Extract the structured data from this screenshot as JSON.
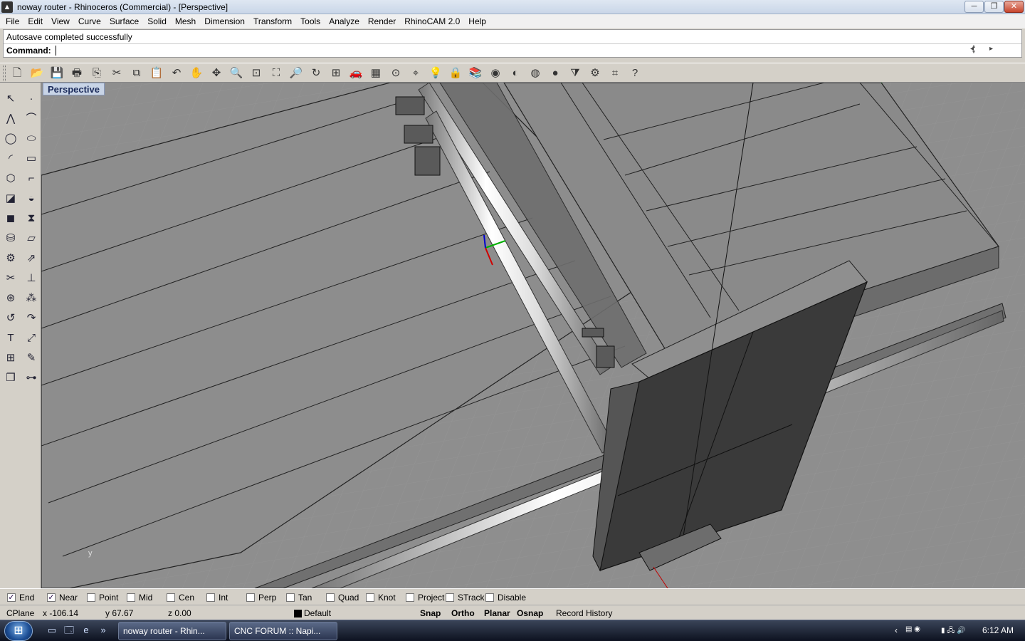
{
  "window": {
    "title": "noway router - Rhinoceros (Commercial) - [Perspective]",
    "buttons": {
      "minimize": "─",
      "maximize": "❐",
      "close": "✕"
    }
  },
  "menu": [
    "File",
    "Edit",
    "View",
    "Curve",
    "Surface",
    "Solid",
    "Mesh",
    "Dimension",
    "Transform",
    "Tools",
    "Analyze",
    "Render",
    "RhinoCAM 2.0",
    "Help"
  ],
  "command": {
    "history": "Autosave completed successfully",
    "label": "Command:",
    "value": ""
  },
  "toolbar": [
    {
      "name": "new-icon",
      "glyph": "🗋"
    },
    {
      "name": "open-icon",
      "glyph": "📂"
    },
    {
      "name": "save-icon",
      "glyph": "💾"
    },
    {
      "name": "print-icon",
      "glyph": "🖶"
    },
    {
      "name": "import-icon",
      "glyph": "⎘"
    },
    {
      "name": "cut-icon",
      "glyph": "✂"
    },
    {
      "name": "copy-icon",
      "glyph": "⧉"
    },
    {
      "name": "paste-icon",
      "glyph": "📋"
    },
    {
      "name": "undo-icon",
      "glyph": "↶"
    },
    {
      "name": "pan-icon",
      "glyph": "✋"
    },
    {
      "name": "move-view-icon",
      "glyph": "✥"
    },
    {
      "name": "zoom-icon",
      "glyph": "🔍"
    },
    {
      "name": "zoom-window-icon",
      "glyph": "⊡"
    },
    {
      "name": "zoom-extents-icon",
      "glyph": "⛶"
    },
    {
      "name": "zoom-selected-icon",
      "glyph": "🔎"
    },
    {
      "name": "rotate-view-icon",
      "glyph": "↻"
    },
    {
      "name": "viewport-layout-icon",
      "glyph": "⊞"
    },
    {
      "name": "car-icon",
      "glyph": "🚗"
    },
    {
      "name": "grid-icon",
      "glyph": "▦"
    },
    {
      "name": "point-icon",
      "glyph": "⊙"
    },
    {
      "name": "snap-icon",
      "glyph": "⌖"
    },
    {
      "name": "light-icon",
      "glyph": "💡"
    },
    {
      "name": "lock-icon",
      "glyph": "🔒"
    },
    {
      "name": "layer-icon",
      "glyph": "📚"
    },
    {
      "name": "color-wheel-icon",
      "glyph": "◉"
    },
    {
      "name": "shade-icon",
      "glyph": "◐"
    },
    {
      "name": "wire-sphere-icon",
      "glyph": "◍"
    },
    {
      "name": "render-sphere-icon",
      "glyph": "●"
    },
    {
      "name": "filter-icon",
      "glyph": "⧩"
    },
    {
      "name": "settings-icon",
      "glyph": "⚙"
    },
    {
      "name": "dimension-icon",
      "glyph": "⌗"
    },
    {
      "name": "help-icon",
      "glyph": "?"
    }
  ],
  "left_toolbar": [
    {
      "name": "select-icon",
      "glyph": "↖"
    },
    {
      "name": "point-icon",
      "glyph": "·"
    },
    {
      "name": "polyline-icon",
      "glyph": "⋀"
    },
    {
      "name": "curve-icon",
      "glyph": "⌒"
    },
    {
      "name": "circle-icon",
      "glyph": "◯"
    },
    {
      "name": "ellipse-icon",
      "glyph": "⬭"
    },
    {
      "name": "arc-icon",
      "glyph": "◜"
    },
    {
      "name": "rectangle-icon",
      "glyph": "▭"
    },
    {
      "name": "polygon-icon",
      "glyph": "⬡"
    },
    {
      "name": "fillet-icon",
      "glyph": "⌐"
    },
    {
      "name": "surface-icon",
      "glyph": "◪"
    },
    {
      "name": "loft-icon",
      "glyph": "◒"
    },
    {
      "name": "box-icon",
      "glyph": "◼"
    },
    {
      "name": "boolean-icon",
      "glyph": "⧗"
    },
    {
      "name": "cylinder-icon",
      "glyph": "⛁"
    },
    {
      "name": "plane-icon",
      "glyph": "▱"
    },
    {
      "name": "mesh-icon",
      "glyph": "⚙"
    },
    {
      "name": "extrude-icon",
      "glyph": "⇗"
    },
    {
      "name": "trim-icon",
      "glyph": "✂"
    },
    {
      "name": "split-icon",
      "glyph": "⊥"
    },
    {
      "name": "join-icon",
      "glyph": "⊛"
    },
    {
      "name": "explode-icon",
      "glyph": "⁂"
    },
    {
      "name": "rotate-icon",
      "glyph": "↺"
    },
    {
      "name": "move-icon",
      "glyph": "↷"
    },
    {
      "name": "text-icon",
      "glyph": "T"
    },
    {
      "name": "scale-icon",
      "glyph": "⤢"
    },
    {
      "name": "array-icon",
      "glyph": "⊞"
    },
    {
      "name": "edit-icon",
      "glyph": "✎"
    },
    {
      "name": "solid-box-icon",
      "glyph": "❒"
    },
    {
      "name": "dimension-icon",
      "glyph": "⊶"
    }
  ],
  "viewport": {
    "title": "Perspective",
    "axis_label": "y"
  },
  "osnaps": [
    {
      "label": "End",
      "checked": true
    },
    {
      "label": "Near",
      "checked": true
    },
    {
      "label": "Point",
      "checked": false
    },
    {
      "label": "Mid",
      "checked": false
    },
    {
      "label": "Cen",
      "checked": false
    },
    {
      "label": "Int",
      "checked": false
    },
    {
      "label": "Perp",
      "checked": false
    },
    {
      "label": "Tan",
      "checked": false
    },
    {
      "label": "Quad",
      "checked": false
    },
    {
      "label": "Knot",
      "checked": false
    },
    {
      "label": "Project",
      "checked": false
    },
    {
      "label": "STrack",
      "checked": false
    },
    {
      "label": "Disable",
      "checked": false
    }
  ],
  "status": {
    "cplane": "CPlane",
    "x": "x -106.14",
    "y": "y 67.67",
    "z": "z 0.00",
    "layer": "Default",
    "snap": "Snap",
    "ortho": "Ortho",
    "planar": "Planar",
    "osnap": "Osnap",
    "record_history": "Record History"
  },
  "taskbar": {
    "start": "⊞",
    "quicklaunch": [
      {
        "name": "show-desktop-icon",
        "glyph": "▭"
      },
      {
        "name": "explorer-icon",
        "glyph": "🗔"
      },
      {
        "name": "ie-icon",
        "glyph": "e"
      },
      {
        "name": "more-icon",
        "glyph": "»"
      }
    ],
    "buttons": [
      "noway router - Rhin...",
      "CNC FORUM :: Napi..."
    ],
    "tray_arrow": "‹",
    "clock": "6:12 AM"
  }
}
